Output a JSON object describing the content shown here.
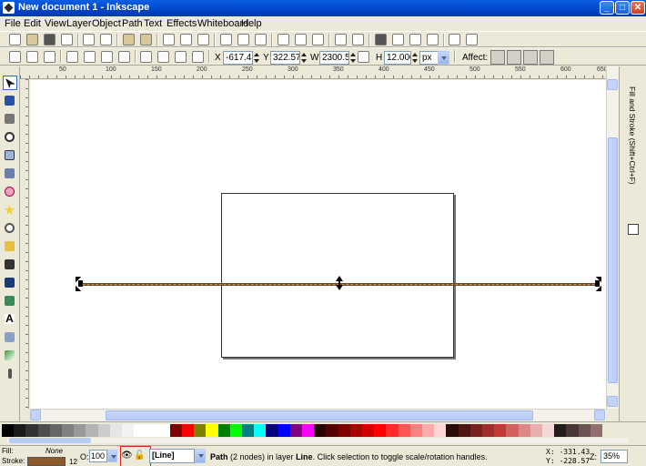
{
  "window": {
    "title": "New document 1 - Inkscape"
  },
  "menu": [
    "File",
    "Edit",
    "View",
    "Layer",
    "Object",
    "Path",
    "Text",
    "Effects",
    "Whiteboard",
    "Help"
  ],
  "select_toolbar": {
    "x_label": "X",
    "x_value": "-617.42",
    "y_label": "Y",
    "y_value": "322.571",
    "w_label": "W",
    "w_value": "2300.57",
    "h_label": "H",
    "h_value": "12.000",
    "unit": "px",
    "affect_label": "Affect:"
  },
  "ruler": [
    "50",
    "100",
    "150",
    "200",
    "250",
    "300",
    "350",
    "400",
    "450",
    "500",
    "550",
    "600",
    "650"
  ],
  "dock": {
    "tab_label": "Fill and Stroke (Shift+Ctrl+F)"
  },
  "palette_colors": [
    "#000000",
    "#1a1a1a",
    "#333333",
    "#4d4d4d",
    "#666666",
    "#808080",
    "#999999",
    "#b3b3b3",
    "#cccccc",
    "#e6e6e6",
    "#f2f2f2",
    "#ffffff",
    "#ffffff",
    "#ffffff",
    "#800000",
    "#ff0000",
    "#808000",
    "#ffff00",
    "#008000",
    "#00ff00",
    "#008080",
    "#00ffff",
    "#000080",
    "#0000ff",
    "#800080",
    "#ff00ff",
    "#2b0000",
    "#550000",
    "#800000",
    "#aa0000",
    "#d40000",
    "#ff0000",
    "#ff2a2a",
    "#ff5555",
    "#ff8080",
    "#ffaaaa",
    "#ffd5d5",
    "#280b0b",
    "#501616",
    "#782121",
    "#a02c2c",
    "#c83737",
    "#d35f5f",
    "#de8787",
    "#e9afaf",
    "#f4d7d7",
    "#241c1c",
    "#483737",
    "#6c5353",
    "#916f6f"
  ],
  "status": {
    "fill_label": "Fill:",
    "fill_value": "None",
    "stroke_label": "Stroke:",
    "stroke_color": "#8b5a2b",
    "stroke_width": "12",
    "opacity_label": "O:",
    "opacity_value": "100",
    "layer_value": "[Line]",
    "message_bold": "Path",
    "message_mid": " (2 nodes) in layer ",
    "message_layer": "Line",
    "message_end": ". Click selection to toggle scale/rotation handles.",
    "cursor_x": "X:  -331.43",
    "cursor_y": "Y:  -228.57",
    "zoom_label": "Z:",
    "zoom_value": "35%"
  }
}
